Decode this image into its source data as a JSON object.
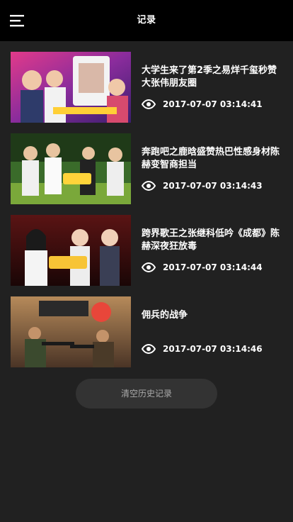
{
  "header": {
    "title": "记录"
  },
  "history": {
    "items": [
      {
        "title": "大学生来了第2季之易烊千玺秒赞大张伟朋友圈",
        "time": "2017-07-07 03:14:41"
      },
      {
        "title": "奔跑吧之鹿晗盛赞热巴性感身材陈赫变智商担当",
        "time": "2017-07-07 03:14:43"
      },
      {
        "title": "跨界歌王之张继科低吟《成都》陈赫深夜狂放毒",
        "time": "2017-07-07 03:14:44"
      },
      {
        "title": "佣兵的战争",
        "time": "2017-07-07 03:14:46"
      }
    ]
  },
  "actions": {
    "clear_label": "清空历史记录"
  },
  "icons": {
    "menu": "menu-icon",
    "views": "eye-icon"
  },
  "colors": {
    "header_bg": "#000000",
    "page_bg": "#212121",
    "button_bg": "#333333"
  }
}
